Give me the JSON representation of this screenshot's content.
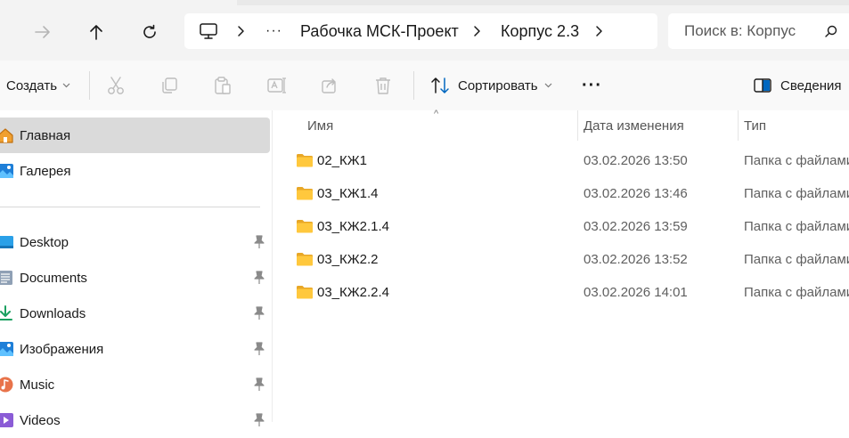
{
  "address_bar": {
    "breadcrumbs": [
      "Рабочка МСК-Проект",
      "Корпус 2.3"
    ],
    "ellipsis": "···",
    "search_placeholder": "Поиск в: Корпус"
  },
  "toolbar": {
    "create_label": "Создать",
    "sort_label": "Сортировать",
    "more_label": "···",
    "details_label": "Сведения"
  },
  "sidebar": {
    "home_label": "Главная",
    "gallery_label": "Галерея",
    "pinned": [
      {
        "label": "Desktop",
        "icon": "desktop-icon"
      },
      {
        "label": "Documents",
        "icon": "documents-icon"
      },
      {
        "label": "Downloads",
        "icon": "downloads-icon"
      },
      {
        "label": "Изображения",
        "icon": "pictures-icon"
      },
      {
        "label": "Music",
        "icon": "music-icon"
      },
      {
        "label": "Videos",
        "icon": "videos-icon"
      }
    ]
  },
  "file_list": {
    "columns": [
      "Имя",
      "Дата изменения",
      "Тип"
    ],
    "rows": [
      {
        "name": "02_КЖ1",
        "date": "03.02.2026 13:50",
        "type": "Папка с файлами"
      },
      {
        "name": "03_КЖ1.4",
        "date": "03.02.2026 13:46",
        "type": "Папка с файлами"
      },
      {
        "name": "03_КЖ2.1.4",
        "date": "03.02.2026 13:59",
        "type": "Папка с файлами"
      },
      {
        "name": "03_КЖ2.2",
        "date": "03.02.2026 13:52",
        "type": "Папка с файлами"
      },
      {
        "name": "03_КЖ2.2.4",
        "date": "03.02.2026 14:01",
        "type": "Папка с файлами"
      }
    ]
  },
  "colors": {
    "accent_blue": "#0067c0",
    "folder_yellow": "#ffc83d",
    "selected_bg": "#dadada"
  }
}
